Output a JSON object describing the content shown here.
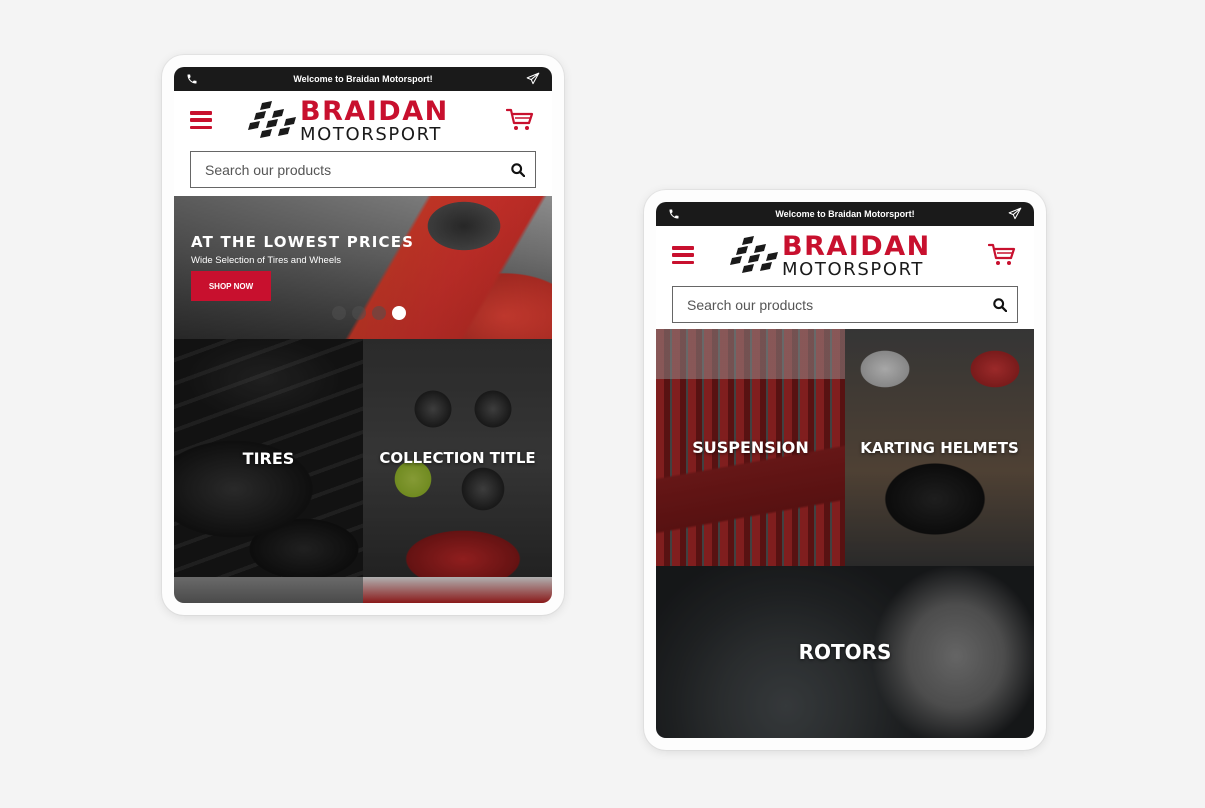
{
  "brand": {
    "line1": "BRAIDAN",
    "line2": "MOTORSPORT",
    "primary_color": "#c8102e",
    "dark_color": "#1a1a1a"
  },
  "topbar": {
    "welcome": "Welcome to Braidan Motorsport!",
    "left_icon": "phone-icon",
    "right_icon": "send-icon"
  },
  "header": {
    "menu_icon": "hamburger-menu-icon",
    "cart_icon": "cart-icon"
  },
  "search": {
    "placeholder": "Search our products",
    "icon": "search-icon"
  },
  "hero": {
    "headline": "AT THE LOWEST PRICES",
    "subtext": "Wide Selection of Tires and Wheels",
    "cta": "SHOP NOW",
    "slide_count": 4,
    "active_slide": 4
  },
  "screen_a_tiles": [
    {
      "title": "TIRES"
    },
    {
      "title": "COLLECTION TITLE"
    },
    {
      "title": ""
    },
    {
      "title": ""
    }
  ],
  "screen_b_tiles": [
    {
      "title": "SUSPENSION"
    },
    {
      "title": "KARTING HELMETS"
    },
    {
      "title": "ROTORS"
    }
  ]
}
